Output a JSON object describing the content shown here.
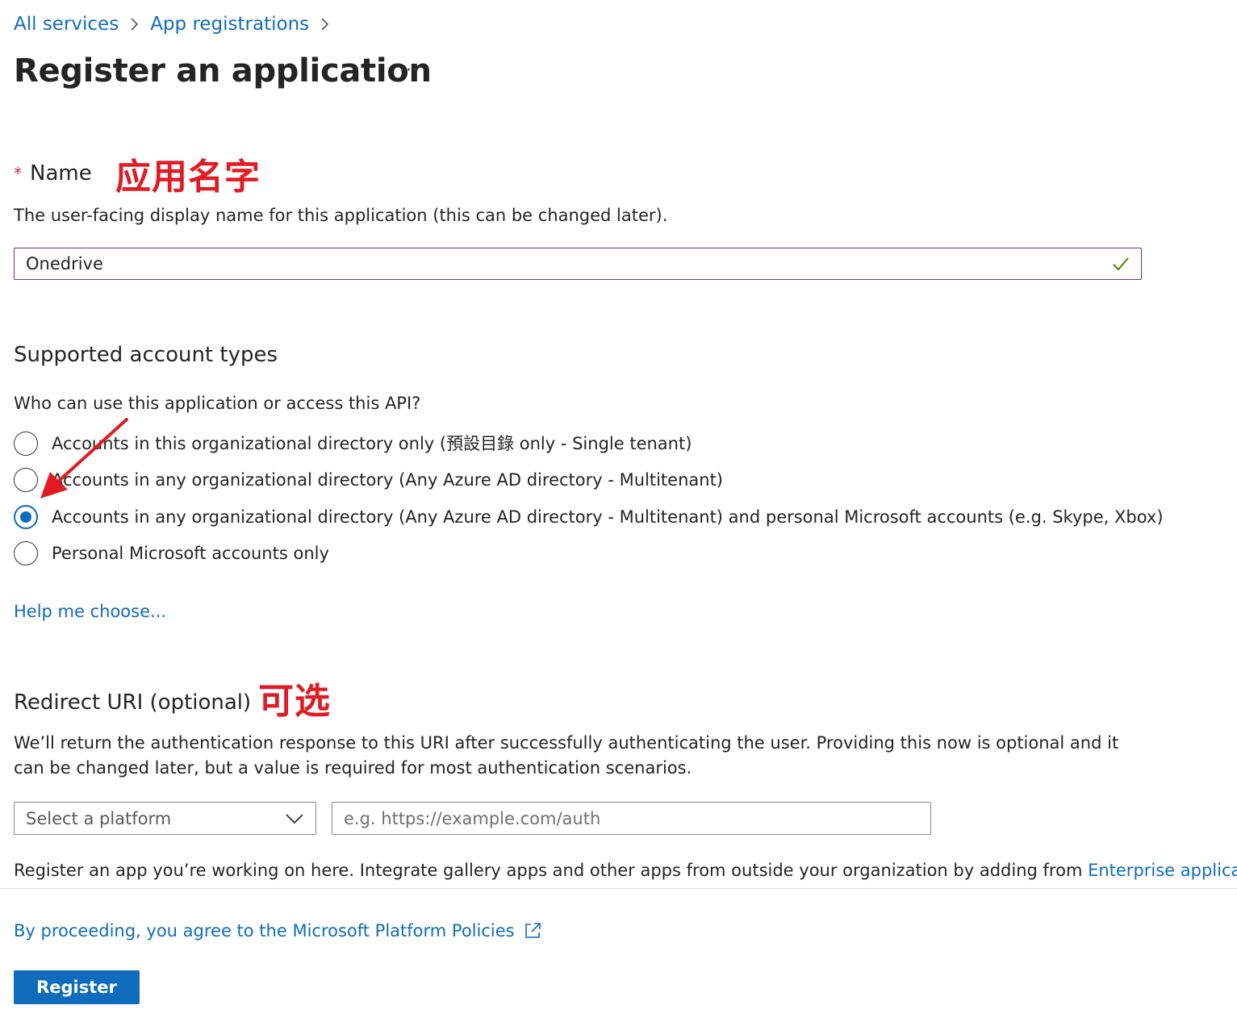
{
  "breadcrumb": {
    "items": [
      "All services",
      "App registrations"
    ]
  },
  "page": {
    "title": "Register an application",
    "more_label": "···"
  },
  "name_field": {
    "required_mark": "*",
    "label": "Name",
    "annotation": "应用名字",
    "description": "The user-facing display name for this application (this can be changed later).",
    "value": "Onedrive",
    "valid_icon": "checkmark-icon"
  },
  "account_types": {
    "heading": "Supported account types",
    "question": "Who can use this application or access this API?",
    "options": [
      {
        "label": "Accounts in this organizational directory only (預設目錄 only - Single tenant)",
        "checked": false
      },
      {
        "label": "Accounts in any organizational directory (Any Azure AD directory - Multitenant)",
        "checked": false
      },
      {
        "label": "Accounts in any organizational directory (Any Azure AD directory - Multitenant) and personal Microsoft accounts (e.g. Skype, Xbox)",
        "checked": true
      },
      {
        "label": "Personal Microsoft accounts only",
        "checked": false
      }
    ],
    "help_link": "Help me choose..."
  },
  "redirect_uri": {
    "heading": "Redirect URI (optional)",
    "annotation": "可选",
    "description": "We’ll return the authentication response to this URI after successfully authenticating the user. Providing this now is optional and it can be changed later, but a value is required for most authentication scenarios.",
    "platform_placeholder": "Select a platform",
    "uri_placeholder": "e.g. https://example.com/auth"
  },
  "footer": {
    "note_prefix": "Register an app you’re working on here. Integrate gallery apps and other apps from outside your organization by adding from ",
    "note_link": "Enterprise applications",
    "note_suffix": ".",
    "policies_link": "By proceeding, you agree to the Microsoft Platform Policies",
    "register_label": "Register"
  },
  "colors": {
    "link": "#0f6cbd",
    "primary_button": "#0f6cbd",
    "annotation_red": "#e01b24",
    "input_focus_border": "#7a2d8f",
    "valid_check": "#498205"
  }
}
